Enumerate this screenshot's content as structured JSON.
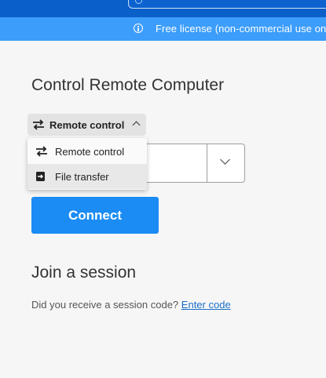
{
  "banner": {
    "icon": "info-icon",
    "text": "Free license (non-commercial use only"
  },
  "connect_section": {
    "title": "Control Remote Computer",
    "mode_selector": {
      "selected": "Remote control",
      "icon": "swap-arrows-icon",
      "expanded": true
    },
    "dropdown_options": [
      {
        "label": "Remote control",
        "icon": "swap-arrows-icon",
        "highlighted": false
      },
      {
        "label": "File transfer",
        "icon": "file-transfer-icon",
        "highlighted": true
      }
    ],
    "partner_id_value": "",
    "connect_label": "Connect"
  },
  "join_section": {
    "title": "Join a session",
    "prompt": "Did you receive a session code?",
    "link_label": "Enter code"
  },
  "colors": {
    "top_bar": "#0b5fc8",
    "banner": "#3c9dfb",
    "primary_button": "#1a8cf3",
    "link": "#1a6ec8"
  }
}
